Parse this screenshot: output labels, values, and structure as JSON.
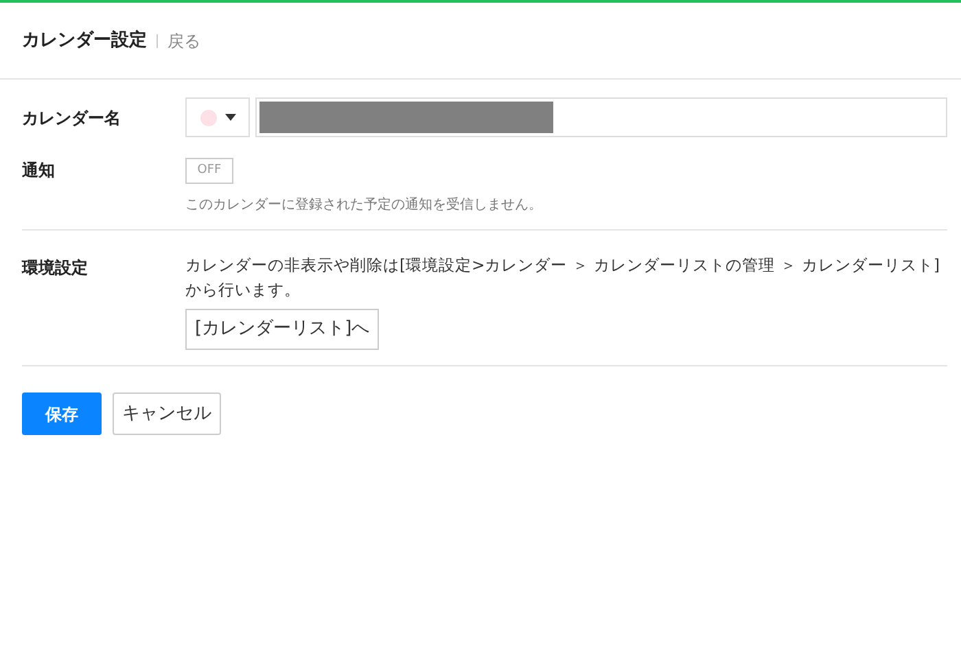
{
  "header": {
    "title": "カレンダー設定",
    "back_link": "戻る"
  },
  "calendar_name": {
    "label": "カレンダー名",
    "color": "#fde1e6"
  },
  "notification": {
    "label": "通知",
    "toggle_text": "OFF",
    "on": false,
    "note": "このカレンダーに登録された予定の通知を受信しません。"
  },
  "preferences": {
    "label": "環境設定",
    "description": "カレンダーの非表示や削除は[環境設定>カレンダー ＞ カレンダーリストの管理 ＞ カレンダーリスト]から行います。",
    "button": "[カレンダーリスト]へ"
  },
  "actions": {
    "save": "保存",
    "cancel": "キャンセル"
  }
}
